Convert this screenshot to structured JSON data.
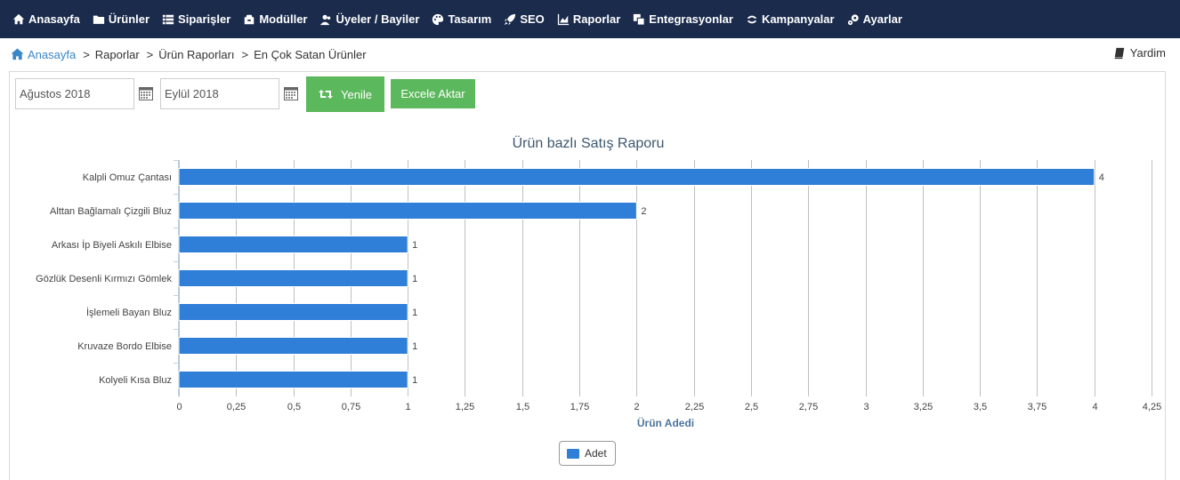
{
  "nav": {
    "items": [
      {
        "label": "Anasayfa",
        "icon": "home-icon"
      },
      {
        "label": "Ürünler",
        "icon": "folder-icon"
      },
      {
        "label": "Siparişler",
        "icon": "list-icon"
      },
      {
        "label": "Modüller",
        "icon": "module-icon"
      },
      {
        "label": "Üyeler / Bayiler",
        "icon": "users-icon"
      },
      {
        "label": "Tasarım",
        "icon": "palette-icon"
      },
      {
        "label": "SEO",
        "icon": "rocket-icon"
      },
      {
        "label": "Raporlar",
        "icon": "chart-icon"
      },
      {
        "label": "Entegrasyonlar",
        "icon": "copy-icon"
      },
      {
        "label": "Kampanyalar",
        "icon": "campaign-icon"
      },
      {
        "label": "Ayarlar",
        "icon": "gear-icon"
      }
    ]
  },
  "breadcrumb": {
    "home": "Anasayfa",
    "items": [
      "Raporlar",
      "Ürün Raporları",
      "En Çok Satan Ürünler"
    ],
    "separator": ">"
  },
  "help": {
    "label": "Yardim"
  },
  "filters": {
    "start_date": "Ağustos 2018",
    "end_date": "Eylül 2018",
    "refresh_label": "Yenile",
    "export_label": "Excele Aktar"
  },
  "colors": {
    "nav_bg": "#1a2b4c",
    "bar": "#2f7ed8",
    "button": "#5cb85c",
    "link": "#3a87c8"
  },
  "chart_data": {
    "type": "bar",
    "orientation": "horizontal",
    "title": "Ürün bazlı Satış Raporu",
    "xlabel": "Ürün Adedi",
    "categories": [
      "Kalpli Omuz Çantası",
      "Alttan Bağlamalı Çizgili Bluz",
      "Arkası İp Biyeli Askılı Elbise",
      "Gözlük Desenli Kırmızı Gömlek",
      "İşlemeli Bayan Bluz",
      "Kruvaze Bordo Elbise",
      "Kolyeli Kısa Bluz"
    ],
    "series": [
      {
        "name": "Adet",
        "values": [
          4,
          2,
          1,
          1,
          1,
          1,
          1
        ]
      }
    ],
    "value_labels": [
      "4",
      "2",
      "1",
      "1",
      "1",
      "1",
      "1"
    ],
    "xlim": [
      0,
      4.25
    ],
    "xticks": [
      0,
      0.25,
      0.5,
      0.75,
      1,
      1.25,
      1.5,
      1.75,
      2,
      2.25,
      2.5,
      2.75,
      3,
      3.25,
      3.5,
      3.75,
      4,
      4.25
    ],
    "xtick_labels": [
      "0",
      "0,25",
      "0,5",
      "0,75",
      "1",
      "1,25",
      "1,5",
      "1,75",
      "2",
      "2,25",
      "2,5",
      "2,75",
      "3",
      "3,25",
      "3,5",
      "3,75",
      "4",
      "4,25"
    ],
    "grid": true,
    "legend": "bottom-center"
  }
}
